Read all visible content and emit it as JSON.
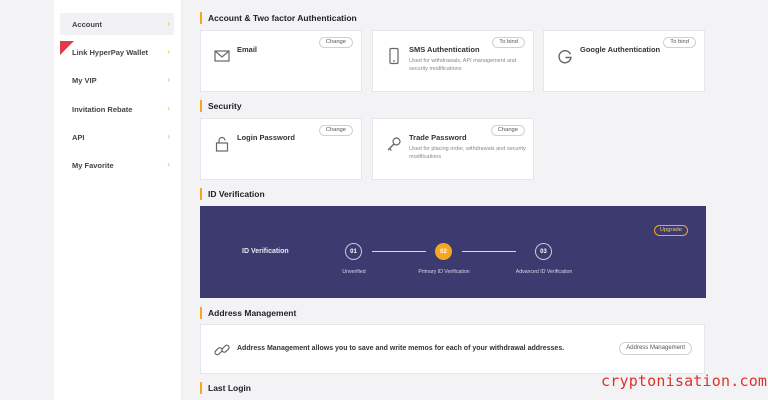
{
  "sidebar": {
    "items": [
      {
        "label": "Account",
        "active": true
      },
      {
        "label": "Link HyperPay Wallet",
        "badge": "new"
      },
      {
        "label": "My VIP"
      },
      {
        "label": "Invitation Rebate"
      },
      {
        "label": "API"
      },
      {
        "label": "My Favorite"
      }
    ]
  },
  "sections": {
    "account_2fa": "Account & Two factor Authentication",
    "security": "Security",
    "id_verification": "ID Verification",
    "address_management": "Address Management",
    "last_login": "Last Login"
  },
  "auth_cards": [
    {
      "title": "Email",
      "action": "Change",
      "icon": "email-icon"
    },
    {
      "title": "SMS Authentication",
      "action": "To bind",
      "desc": "Used for withdrawals, API management and security modifications",
      "icon": "phone-icon"
    },
    {
      "title": "Google Authentication",
      "action": "To bind",
      "icon": "google-icon"
    }
  ],
  "security_cards": [
    {
      "title": "Login Password",
      "action": "Change",
      "icon": "lock-icon"
    },
    {
      "title": "Trade Password",
      "action": "Change",
      "desc": "Used for placing order, withdrawals and security modifications",
      "icon": "key-icon"
    }
  ],
  "id_banner": {
    "label": "ID Verification",
    "upgrade": "Upgrade",
    "steps": [
      {
        "num": "01",
        "caption": "Unverified"
      },
      {
        "num": "02",
        "caption": "Primary ID Verification",
        "current": true
      },
      {
        "num": "03",
        "caption": "Advanced ID Verification"
      }
    ]
  },
  "address": {
    "text": "Address Management allows you to save and write memos for each of your withdrawal addresses.",
    "button": "Address Management",
    "icon": "link-icon"
  },
  "watermark": "cryptonisation.com",
  "colors": {
    "accent": "#f5a623",
    "banner": "#3c3a6e",
    "watermark": "#d8342c"
  }
}
